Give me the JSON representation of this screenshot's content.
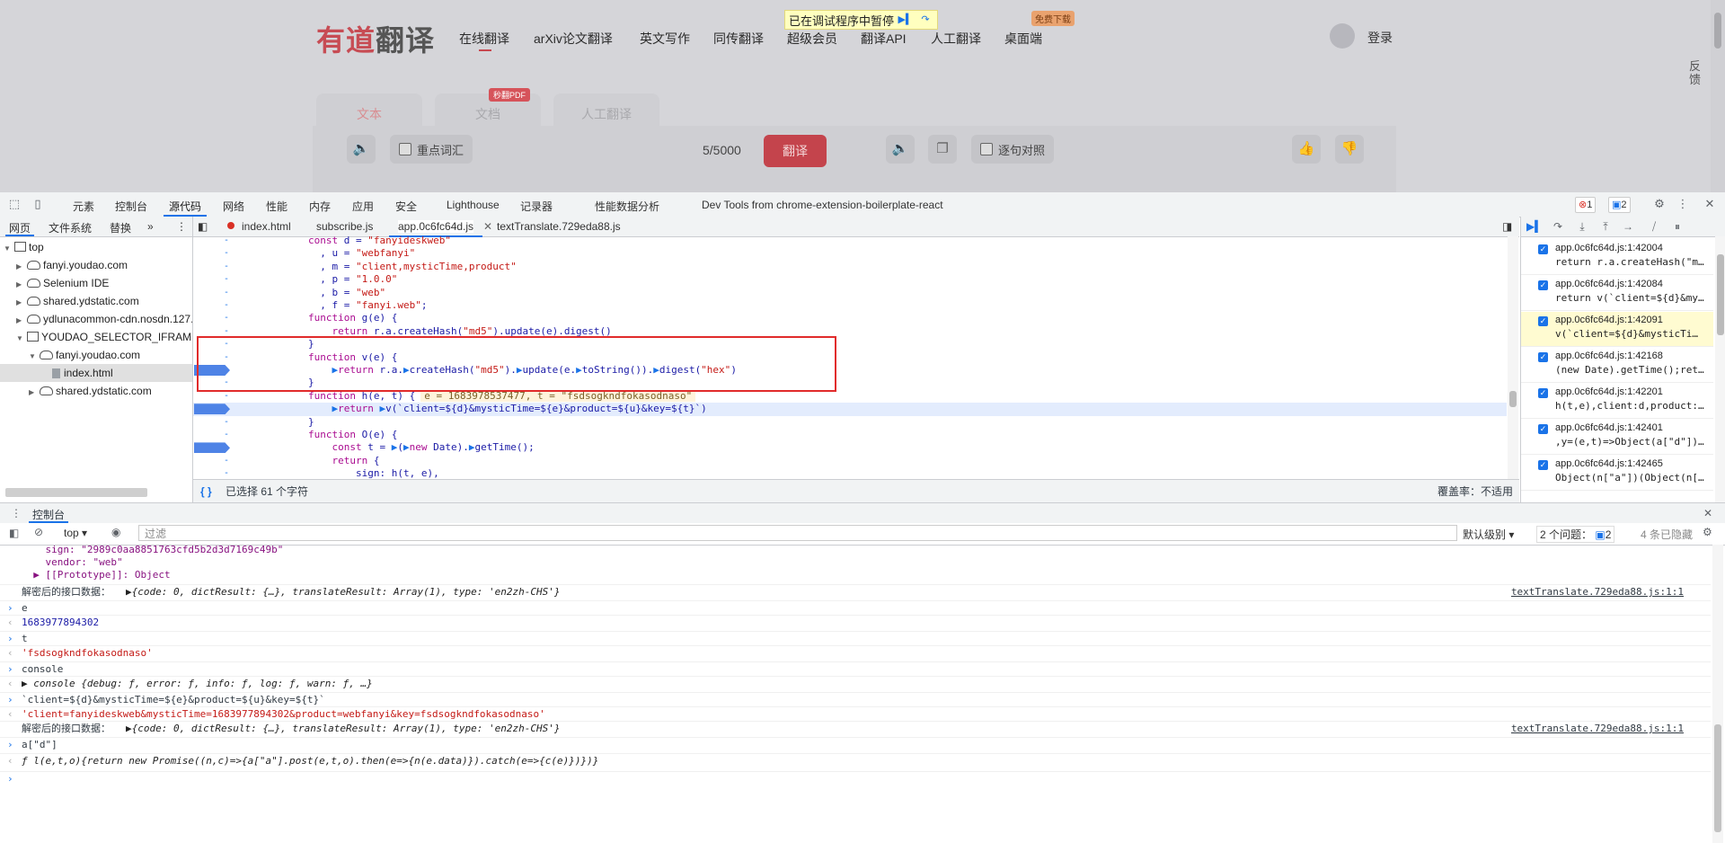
{
  "page": {
    "logo_red": "有道",
    "logo_dark": "翻译",
    "nav": [
      "在线翻译",
      "arXiv论文翻译",
      "英文写作",
      "同传翻译",
      "超级会员",
      "翻译API",
      "人工翻译",
      "桌面端"
    ],
    "free_download_badge": "免费下载",
    "paused_banner": "已在调试程序中暂停",
    "login": "登录",
    "feedback": "反馈",
    "tabs": [
      "文本",
      "文档",
      "人工翻译"
    ],
    "pdf_badge": "秒翻PDF",
    "key_vocab": "重点词汇",
    "char_count": "5/5000",
    "translate_button": "翻译",
    "sentence_compare": "逐句对照"
  },
  "devtools": {
    "main_tabs": [
      "元素",
      "控制台",
      "源代码",
      "网络",
      "性能",
      "内存",
      "应用",
      "安全",
      "Lighthouse",
      "记录器",
      "性能数据分析",
      "Dev Tools from chrome-extension-boilerplate-react"
    ],
    "error_count": "1",
    "message_count": "2",
    "navigator_tabs": [
      "网页",
      "文件系统",
      "替换"
    ],
    "tree": [
      {
        "label": "top",
        "kind": "frame",
        "indent": 0,
        "open": true
      },
      {
        "label": "fanyi.youdao.com",
        "kind": "cloud",
        "indent": 1,
        "open": false
      },
      {
        "label": "Selenium IDE",
        "kind": "cloud",
        "indent": 1,
        "open": false
      },
      {
        "label": "shared.ydstatic.com",
        "kind": "cloud",
        "indent": 1,
        "open": false
      },
      {
        "label": "ydlunacommon-cdn.nosdn.127.",
        "kind": "cloud",
        "indent": 1,
        "open": false
      },
      {
        "label": "YOUDAO_SELECTOR_IFRAME (ir",
        "kind": "frame",
        "indent": 1,
        "open": true
      },
      {
        "label": "fanyi.youdao.com",
        "kind": "cloud",
        "indent": 2,
        "open": true
      },
      {
        "label": "index.html",
        "kind": "file",
        "indent": 3,
        "open": false,
        "selected": true
      },
      {
        "label": "shared.ydstatic.com",
        "kind": "cloud",
        "indent": 2,
        "open": false
      }
    ],
    "editor_tabs": [
      "index.html",
      "subscribe.js",
      "app.0c6fc64d.js",
      "textTranslate.729eda88.js"
    ],
    "code_lines": [
      {
        "gutter": "-",
        "text": "const d = \"fanyideskweb\"",
        "bp": false,
        "hl": false
      },
      {
        "gutter": "-",
        "text": "  , u = \"webfanyi\"",
        "bp": false,
        "hl": false
      },
      {
        "gutter": "-",
        "text": "  , m = \"client,mysticTime,product\"",
        "bp": false,
        "hl": false
      },
      {
        "gutter": "-",
        "text": "  , p = \"1.0.0\"",
        "bp": false,
        "hl": false
      },
      {
        "gutter": "-",
        "text": "  , b = \"web\"",
        "bp": false,
        "hl": false
      },
      {
        "gutter": "-",
        "text": "  , f = \"fanyi.web\";",
        "bp": false,
        "hl": false
      },
      {
        "gutter": "-",
        "text": "function g(e) {",
        "bp": false,
        "hl": false
      },
      {
        "gutter": "-",
        "text": "    return r.a.createHash(\"md5\").update(e).digest()",
        "bp": false,
        "hl": false
      },
      {
        "gutter": "-",
        "text": "}",
        "bp": false,
        "hl": false
      },
      {
        "gutter": "-",
        "text": "function v(e) {",
        "bp": false,
        "hl": false
      },
      {
        "gutter": "-",
        "text": "    ▶return r.a.▶createHash(\"md5\").▶update(e.▶toString()).▶digest(\"hex\")",
        "bp": true,
        "hl": false
      },
      {
        "gutter": "-",
        "text": "}",
        "bp": false,
        "hl": false
      },
      {
        "gutter": "-",
        "text": "function h(e, t) {",
        "bp": false,
        "hl": false,
        "inline": "e = 1683978537477, t = \"fsdsogkndfokasodnaso\""
      },
      {
        "gutter": "-",
        "text": "    ▶return ▶v(`client=${d}&mysticTime=${e}&product=${u}&key=${t}`)",
        "bp": true,
        "hl": true
      },
      {
        "gutter": "-",
        "text": "}",
        "bp": false,
        "hl": false
      },
      {
        "gutter": "-",
        "text": "function O(e) {",
        "bp": false,
        "hl": false
      },
      {
        "gutter": "-",
        "text": "    const t = ▶(▶new Date).▶getTime();",
        "bp": true,
        "hl": false
      },
      {
        "gutter": "-",
        "text": "    return {",
        "bp": false,
        "hl": false
      },
      {
        "gutter": "-",
        "text": "        sign: h(t, e),",
        "bp": false,
        "hl": false
      }
    ],
    "selection_status": "已选择 61 个字符",
    "coverage_status": "覆盖率：不适用",
    "breakpoints": [
      {
        "loc": "app.0c6fc64d.js:1:42004",
        "src": "return r.a.createHash(\"m…",
        "current": false
      },
      {
        "loc": "app.0c6fc64d.js:1:42084",
        "src": "return v(`client=${d}&my…",
        "current": false
      },
      {
        "loc": "app.0c6fc64d.js:1:42091",
        "src": "v(`client=${d}&mysticTi…",
        "current": true
      },
      {
        "loc": "app.0c6fc64d.js:1:42168",
        "src": "(new Date).getTime();ret…",
        "current": false
      },
      {
        "loc": "app.0c6fc64d.js:1:42201",
        "src": "h(t,e),client:d,product:…",
        "current": false
      },
      {
        "loc": "app.0c6fc64d.js:1:42401",
        "src": ",y=(e,t)=>Object(a[\"d\"])…",
        "current": false
      },
      {
        "loc": "app.0c6fc64d.js:1:42465",
        "src": "Object(n[\"a\"])(Object(n[…",
        "current": false
      }
    ],
    "console": {
      "drawer_title": "控制台",
      "context": "top",
      "filter_placeholder": "过滤",
      "level": "默认级别",
      "issues": "2 个问题：",
      "issues_count": "2",
      "hidden": "4 条已隐藏",
      "rows": [
        {
          "type": "obj",
          "text": "    sign: \"2989c0aa8851763cfd5b2d3d7169c49b\""
        },
        {
          "type": "obj",
          "text": "    vendor: \"web\""
        },
        {
          "type": "obj",
          "text": "  ▶ [[Prototype]]: Object"
        },
        {
          "type": "log",
          "label": "解密后的接口数据：",
          "text": "▶{code: 0, dictResult: {…}, translateResult: Array(1), type: 'en2zh-CHS'}",
          "link": "textTranslate.729eda88.js:1:1"
        },
        {
          "type": "in",
          "text": "e"
        },
        {
          "type": "out-num",
          "text": "1683977894302"
        },
        {
          "type": "in",
          "text": "t"
        },
        {
          "type": "out-str",
          "text": "'fsdsogkndfokasodnaso'"
        },
        {
          "type": "in",
          "text": "console"
        },
        {
          "type": "out-obj",
          "text": "▶ console {debug: ƒ, error: ƒ, info: ƒ, log: ƒ, warn: ƒ, …}"
        },
        {
          "type": "in",
          "text": "`client=${d}&mysticTime=${e}&product=${u}&key=${t}`"
        },
        {
          "type": "out-str",
          "text": "'client=fanyideskweb&mysticTime=1683977894302&product=webfanyi&key=fsdsogkndfokasodnaso'"
        },
        {
          "type": "log",
          "label": "解密后的接口数据：",
          "text": "▶{code: 0, dictResult: {…}, translateResult: Array(1), type: 'en2zh-CHS'}",
          "link": "textTranslate.729eda88.js:1:1"
        },
        {
          "type": "in",
          "text": "a[\"d\"]"
        },
        {
          "type": "out-obj",
          "text": "ƒ l(e,t,o){return new Promise((n,c)=>{a[\"a\"].post(e,t,o).then(e=>{n(e.data)}).catch(e=>{c(e)})})}"
        },
        {
          "type": "prompt",
          "text": ""
        }
      ]
    }
  },
  "colors": {
    "accent": "#1a73e8",
    "brand_red": "#c74c54",
    "highlight_box": "#e12b2b",
    "breakpoint": "#4e83e6"
  }
}
